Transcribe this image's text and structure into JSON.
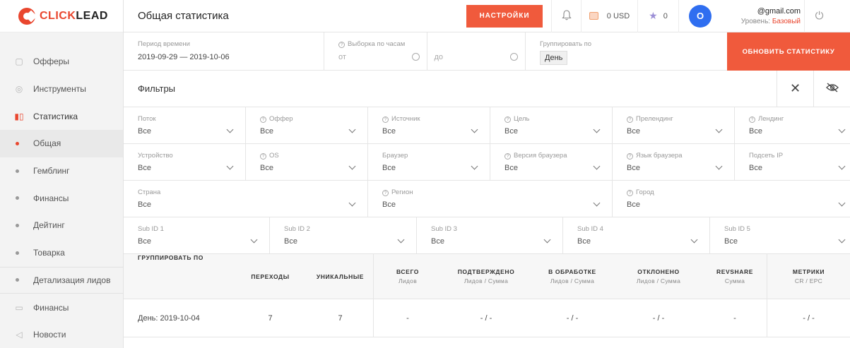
{
  "brand": {
    "name_accent": "CLICK",
    "name_rest": "LEAD"
  },
  "sidebar": {
    "items": [
      {
        "label": "Офферы",
        "icon": "offers-icon"
      },
      {
        "label": "Инструменты",
        "icon": "tools-icon"
      },
      {
        "label": "Статистика",
        "icon": "stats-icon"
      },
      {
        "label": "Общая"
      },
      {
        "label": "Гемблинг"
      },
      {
        "label": "Финансы"
      },
      {
        "label": "Дейтинг"
      },
      {
        "label": "Товарка"
      },
      {
        "label": "Детализация лидов"
      },
      {
        "label": "Финансы",
        "icon": "wallet-icon"
      },
      {
        "label": "Новости",
        "icon": "megaphone-icon"
      }
    ]
  },
  "header": {
    "title": "Общая статистика",
    "settings_label": "НАСТРОЙКИ",
    "balance": "0 USD",
    "stars": "0",
    "avatar_letter": "O",
    "email": "@gmail.com",
    "level_label": "Уровень:",
    "level_value": "Базовый"
  },
  "period": {
    "label": "Период времени",
    "value": "2019-09-29  —  2019-10-06",
    "hours_label": "Выборка по часам",
    "from_placeholder": "от",
    "to_placeholder": "до",
    "group_label": "Группировать по",
    "group_value": "День",
    "update_label": "ОБНОВИТЬ СТАТИСТИКУ"
  },
  "filters": {
    "title": "Фильтры",
    "row1": [
      {
        "label": "Поток",
        "value": "Все"
      },
      {
        "label": "Оффер",
        "value": "Все"
      },
      {
        "label": "Источник",
        "value": "Все"
      },
      {
        "label": "Цель",
        "value": "Все"
      },
      {
        "label": "Прелендинг",
        "value": "Все"
      },
      {
        "label": "Лендинг",
        "value": "Все"
      }
    ],
    "row2": [
      {
        "label": "Устройство",
        "value": "Все"
      },
      {
        "label": "OS",
        "value": "Все"
      },
      {
        "label": "Браузер",
        "value": "Все"
      },
      {
        "label": "Версия браузера",
        "value": "Все"
      },
      {
        "label": "Язык браузера",
        "value": "Все"
      },
      {
        "label": "Подсеть IP",
        "value": "Все"
      }
    ],
    "row3": [
      {
        "label": "Страна",
        "value": "Все"
      },
      {
        "label": "Регион",
        "value": "Все"
      },
      {
        "label": "Город",
        "value": "Все"
      }
    ],
    "row4": [
      {
        "label": "Sub ID 1",
        "value": "Все"
      },
      {
        "label": "Sub ID 2",
        "value": "Все"
      },
      {
        "label": "Sub ID 3",
        "value": "Все"
      },
      {
        "label": "Sub ID 4",
        "value": "Все"
      },
      {
        "label": "Sub ID 5",
        "value": "Все"
      }
    ]
  },
  "table": {
    "headers": [
      {
        "title": "ГРУППИРОВАТЬ ПО",
        "sub": ""
      },
      {
        "title": "ПЕРЕХОДЫ",
        "sub": ""
      },
      {
        "title": "УНИКАЛЬНЫЕ",
        "sub": ""
      },
      {
        "title": "ВСЕГО",
        "sub": "Лидов"
      },
      {
        "title": "ПОДТВЕРЖДЕНО",
        "sub": "Лидов / Сумма"
      },
      {
        "title": "В ОБРАБОТКЕ",
        "sub": "Лидов / Сумма"
      },
      {
        "title": "ОТКЛОНЕНО",
        "sub": "Лидов / Сумма"
      },
      {
        "title": "REVSHARE",
        "sub": "Сумма"
      },
      {
        "title": "МЕТРИКИ",
        "sub": "CR / EPC"
      }
    ],
    "rows": [
      [
        "День: 2019-10-04",
        "7",
        "7",
        "-",
        "- / -",
        "- / -",
        "- / -",
        "-",
        "- / -"
      ]
    ]
  }
}
